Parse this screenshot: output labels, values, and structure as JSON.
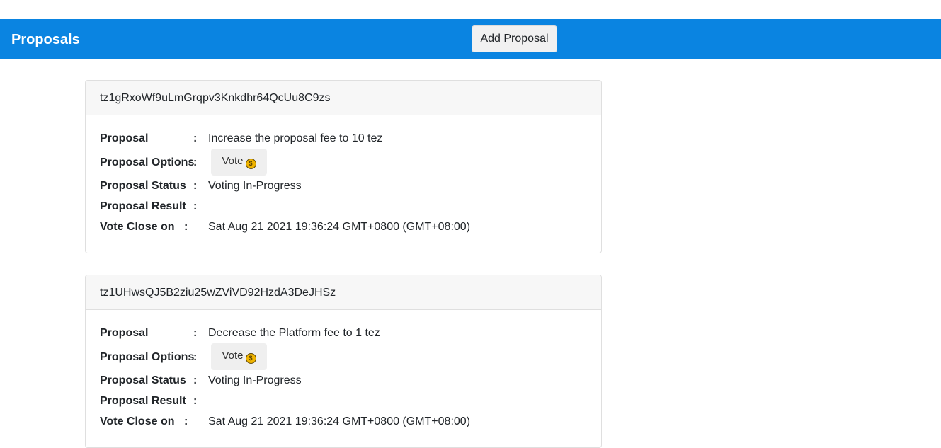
{
  "header": {
    "title": "Proposals",
    "add_button_label": "Add Proposal"
  },
  "labels": {
    "proposal": "Proposal",
    "options": "Proposal Options",
    "status": "Proposal Status",
    "result": "Proposal Result",
    "close": "Vote Close on",
    "separator": ":"
  },
  "proposals": [
    {
      "address": "tz1gRxoWf9uLmGrqpv3Knkdhr64QcUu8C9zs",
      "proposal": "Increase the proposal fee to 10 tez",
      "vote_label": "Vote",
      "vote_icon": "money-bag-icon",
      "status": "Voting In-Progress",
      "result": "",
      "close_on": "Sat Aug 21 2021 19:36:24 GMT+0800 (GMT+08:00)"
    },
    {
      "address": "tz1UHwsQJ5B2ziu25wZViVD92HzdA3DeJHSz",
      "proposal": "Decrease the Platform fee to 1 tez",
      "vote_label": "Vote",
      "vote_icon": "money-bag-icon",
      "status": "Voting In-Progress",
      "result": "",
      "close_on": "Sat Aug 21 2021 19:36:24 GMT+0800 (GMT+08:00)"
    }
  ],
  "colors": {
    "navbar": "#0a84e1",
    "card_header": "#f7f7f7",
    "coin": "#f0b400"
  }
}
